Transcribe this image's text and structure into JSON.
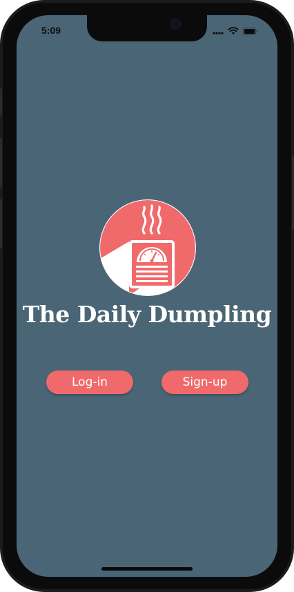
{
  "status_bar": {
    "time": "5:09",
    "icons": [
      "cellular-dots-icon",
      "wifi-icon",
      "battery-icon"
    ]
  },
  "app": {
    "title": "The Daily Dumpling",
    "logo_icon": "newspaper-scale-steam-icon"
  },
  "buttons": {
    "login_label": "Log-in",
    "signup_label": "Sign-up"
  },
  "colors": {
    "background": "#4a6676",
    "accent": "#f06a6c",
    "text": "#ffffff"
  }
}
